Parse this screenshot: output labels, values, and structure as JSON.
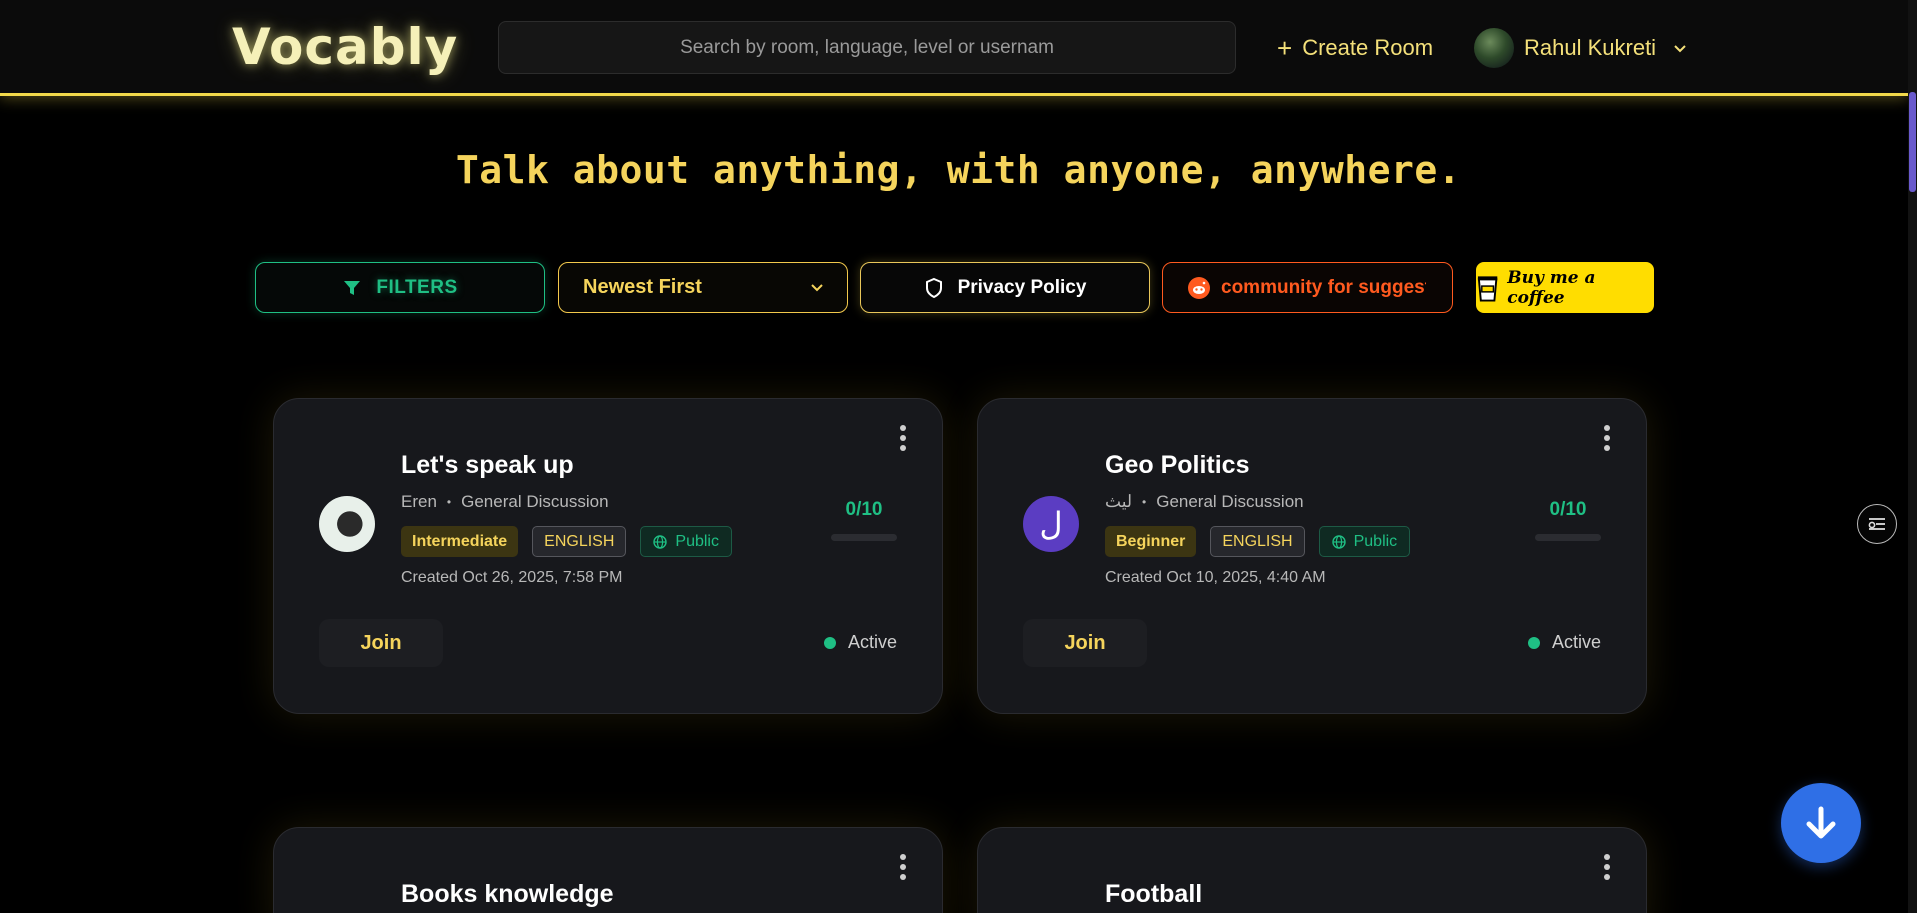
{
  "header": {
    "logo": "Vocably",
    "search_placeholder": "Search by room, language, level or usernam",
    "create_room": "Create Room",
    "user_name": "Rahul Kukreti"
  },
  "tagline": "Talk about anything, with anyone, anywhere.",
  "controls": {
    "filters": "FILTERS",
    "sort": "Newest First",
    "privacy": "Privacy Policy",
    "reddit": "community for suggest",
    "coffee": "Buy me a coffee"
  },
  "rooms": [
    {
      "title": "Let's speak up",
      "host": "Eren",
      "topic": "General Discussion",
      "level": "Intermediate",
      "language": "ENGLISH",
      "visibility": "Public",
      "created": "Created Oct 26, 2025, 7:58 PM",
      "capacity": "0/10",
      "fill": 0,
      "join": "Join",
      "status": "Active"
    },
    {
      "title": "Geo Politics",
      "host": "ليث",
      "avatar_letter": "ل",
      "topic": "General Discussion",
      "level": "Beginner",
      "language": "ENGLISH",
      "visibility": "Public",
      "created": "Created Oct 10, 2025, 4:40 AM",
      "capacity": "0/10",
      "fill": 0,
      "join": "Join",
      "status": "Active"
    },
    {
      "title": "Books knowledge"
    },
    {
      "title": "Football"
    }
  ],
  "colors": {
    "accent_yellow": "#f5d45c",
    "accent_green": "#1fbf84",
    "reddit_orange": "#ff5a1f",
    "fab_blue": "#2f6fe6"
  }
}
